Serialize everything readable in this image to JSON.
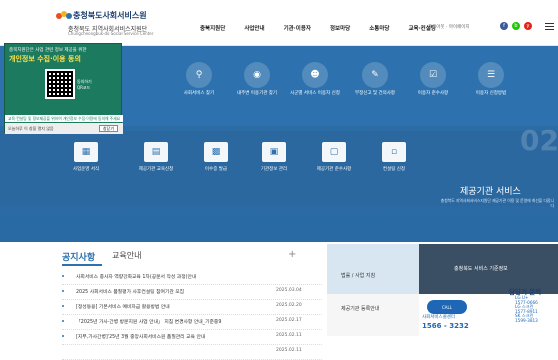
{
  "header": {
    "logo": {
      "line1": "충청북도사회서비스원",
      "line2": "충청북도 지역사회서비스지원단",
      "line3": "Chungcheongbuk-do Social Service Center"
    },
    "gnb": [
      "충북지원단",
      "사업안내",
      "기관·이용자",
      "정보마당",
      "소통마당",
      "교육·컨설팅"
    ],
    "util": "로그아웃 · 마이페이지",
    "social": [
      "f",
      "b",
      "y"
    ],
    "colors": {
      "brand": "#1a3c6e",
      "accent": "#2d72ae",
      "popup": "#1c7a5e"
    }
  },
  "hero": {
    "row1": [
      "사회서비스 찾기",
      "내주변 이용기관 찾기",
      "시군별 서비스 이용자 신청",
      "부정신고 및 건의사항",
      "이용자 준수사항",
      "이용자 신청방법"
    ],
    "row2": [
      "사업운영 서식",
      "제공기관 교육신청",
      "이수증 발급",
      "기관정보 관리",
      "제공기관 준수사항",
      "컨설팅 신청"
    ],
    "panel": {
      "title": "제공기관 서비스",
      "subtitle": "충청북도 지역사회서비스지원단 제공기관 이용 및 운영에 최선을 다합니다"
    },
    "number": "02"
  },
  "popup": {
    "line1": "충북지원단은 사업 관련 정보 제공을 위한",
    "headline": "개인정보 수집·이용 동의",
    "qr_label1": "동의하기",
    "qr_label2": "QR코드",
    "bar": "교육·컨설팅 및 정보제공을 위하여 개인정보 수집·이용에 동의해 주세요",
    "footer": "오늘하루 이 창을 열지 않음",
    "close": "창닫기"
  },
  "notice": {
    "tabs": [
      "공지사항",
      "교육안내"
    ],
    "more": "+",
    "items": [
      {
        "title": "사회서비스 종사자 역량강화교육 1차(공문서 작성 과정)안내",
        "date": ""
      },
      {
        "title": "2025 사회서비스 품질평가 사후컨설팅 참여기관 모집",
        "date": "2025.03.04"
      },
      {
        "title": "[정성동용] 기본서비스 예비자금 활용방법 안내",
        "date": "2025.02.20"
      },
      {
        "title": "「2025년 가사·간병 방문지원 사업 안내」 지침 변경사항 안내_기준중9",
        "date": "2025.02.17"
      },
      {
        "title": "[지부,가사간병]'25년 3월 중앙사회서비스원 품질관리 교육 안내",
        "date": "2025.02.11"
      },
      {
        "title": "",
        "date": "2025.02.11"
      }
    ]
  },
  "banners": {
    "b1": "법률 / 사업 지침",
    "b2": "충청북도 서비스 기준정보",
    "b3": "제공기관 등록안내",
    "call_label": "CALL",
    "center_name": "사회서비스콜센터",
    "center_number": "1566 - 3232",
    "dg_title": "담당기 문의",
    "dg_list": [
      "LG U+",
      "1577-0666",
      "LG 스크린",
      "1577-8911",
      "SK 스크린",
      "1599-3813"
    ]
  }
}
